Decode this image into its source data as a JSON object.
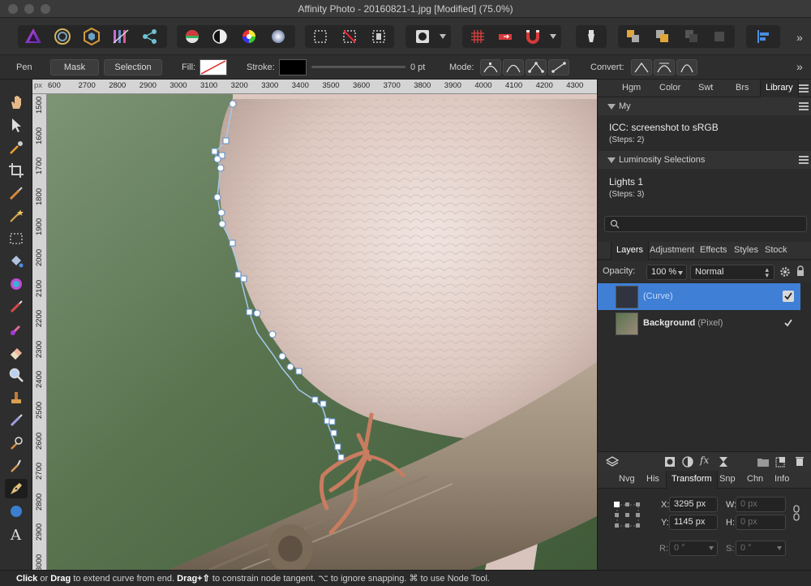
{
  "window": {
    "title": "Affinity Photo - 20160821-1.jpg [Modified] (75.0%)"
  },
  "context_toolbar": {
    "tool_name": "Pen",
    "mask_label": "Mask",
    "selection_label": "Selection",
    "fill_label": "Fill:",
    "stroke_label": "Stroke:",
    "stroke_width": "0 pt",
    "mode_label": "Mode:",
    "convert_label": "Convert:"
  },
  "ruler": {
    "unit": "px",
    "h_ticks": [
      "600",
      "2700",
      "2800",
      "2900",
      "3000",
      "3100",
      "3200",
      "3300",
      "3400",
      "3500",
      "3600",
      "3700",
      "3800",
      "3900",
      "4000",
      "4100",
      "4200",
      "4300"
    ],
    "v_ticks": [
      "1500",
      "1600",
      "1700",
      "1800",
      "1900",
      "2000",
      "2100",
      "2200",
      "2300",
      "2400",
      "2500",
      "2600",
      "2700",
      "2800",
      "2900",
      "3000"
    ]
  },
  "studio_top": {
    "tabs": [
      "Hgm",
      "Color",
      "Swt",
      "Brs",
      "Library"
    ],
    "active_tab": "Library",
    "sections": [
      {
        "title": "My",
        "item_name": "ICC: screenshot to sRGB",
        "item_steps": "(Steps: 2)"
      },
      {
        "title": "Luminosity Selections",
        "item_name": "Lights 1",
        "item_steps": "(Steps: 3)"
      }
    ]
  },
  "layers_panel": {
    "tabs": [
      "Layers",
      "Adjustment",
      "Effects",
      "Styles",
      "Stock"
    ],
    "active_tab": "Layers",
    "opacity_label": "Opacity:",
    "opacity_value": "100 %",
    "blend_mode": "Normal",
    "layers": [
      {
        "name": "",
        "type": "(Curve)",
        "selected": true,
        "visible": true
      },
      {
        "name": "Background",
        "type": "(Pixel)",
        "selected": false,
        "visible": true
      }
    ]
  },
  "transform_panel": {
    "tabs": [
      "Nvg",
      "His",
      "Transform",
      "Snp",
      "Chn",
      "Info"
    ],
    "active_tab": "Transform",
    "x_label": "X:",
    "x_value": "3295 px",
    "y_label": "Y:",
    "y_value": "1145 px",
    "w_label": "W:",
    "w_value": "0 px",
    "h_label": "H:",
    "h_value": "0 px",
    "r_label": "R:",
    "r_value": "0 °",
    "s_label": "S:",
    "s_value": "0 °"
  },
  "status": {
    "b1": "Click",
    "t1": " or ",
    "b2": "Drag",
    "t2": " to extend curve from end. ",
    "b3": "Drag+⇧",
    "t3": " to constrain node tangent. ⌥ to ignore snapping. ⌘ to use Node Tool."
  },
  "colors": {
    "accent": "#3f7fd6",
    "canvas_bg": "#5d7652",
    "panel_bg": "#2b2b2b"
  }
}
